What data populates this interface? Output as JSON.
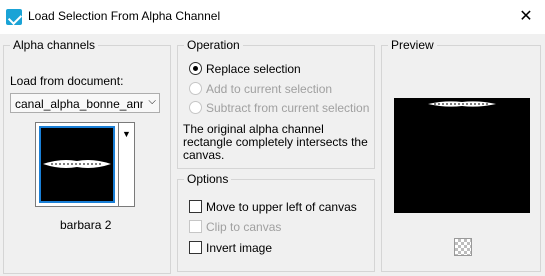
{
  "window": {
    "title": "Load Selection From Alpha Channel",
    "close_glyph": "✕"
  },
  "alpha": {
    "group_title": "Alpha channels",
    "load_label": "Load from document:",
    "document_value": "canal_alpha_bonne_ann",
    "selected_channel": "barbara 2"
  },
  "operation": {
    "group_title": "Operation",
    "options": [
      {
        "label": "Replace selection",
        "checked": true,
        "enabled": true
      },
      {
        "label": "Add to current selection",
        "checked": false,
        "enabled": false
      },
      {
        "label": "Subtract from current selection",
        "checked": false,
        "enabled": false
      }
    ],
    "note_line1": "The original alpha channel",
    "note_line2": "rectangle completely intersects the",
    "note_line3": "canvas."
  },
  "options": {
    "group_title": "Options",
    "items": [
      {
        "label": "Move to upper left of canvas",
        "checked": false,
        "enabled": true
      },
      {
        "label": "Clip to canvas",
        "checked": false,
        "enabled": false
      },
      {
        "label": "Invert image",
        "checked": false,
        "enabled": true
      }
    ]
  },
  "preview": {
    "group_title": "Preview"
  },
  "colors": {
    "accent": "#1a7fd6",
    "preview_bg": "#000000"
  }
}
